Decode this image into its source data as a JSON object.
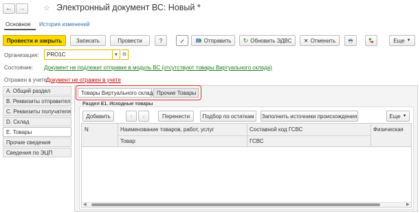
{
  "window": {
    "title": "Электронный документ ВС: Новый *",
    "nav_back": "←",
    "nav_fwd": "→",
    "star": "☆"
  },
  "tabs": {
    "main": "Основное",
    "history": "История изменений"
  },
  "toolbar": {
    "post_close": "Провести и закрыть",
    "save": "Записать",
    "post": "Провести",
    "help": "?",
    "send": "Отправить",
    "refresh": "Обновить ЭДВС",
    "cancel": "Отменить",
    "more": "Еще"
  },
  "form": {
    "org_label": "Организация:",
    "org_value": "PRO1C",
    "state_label": "Состояние:",
    "state_value": "Документ не подлежит отправке в модуль ВС (отсутствуют товары Виртуального склада)",
    "acct_label": "Отражен в учете:",
    "acct_value": "Документ не отражен в учете"
  },
  "sidebar": {
    "items": [
      {
        "label": "А. Общий раздел"
      },
      {
        "label": "В. Реквизиты отправителя"
      },
      {
        "label": "С. Реквизиты получателя"
      },
      {
        "label": "D. Склад"
      },
      {
        "label": "Е. Товары"
      },
      {
        "label": "Прочие сведения"
      },
      {
        "label": "Сведения по ЭЦП"
      }
    ]
  },
  "subtabs": {
    "virtual": "Товары Виртуального склада",
    "other": "Прочие Товары"
  },
  "section": {
    "title": "Раздел Е1. Исходные товары",
    "add": "Добавить",
    "up": "↑",
    "down": "↓",
    "move": "Перенести",
    "pick": "Подбор по остаткам",
    "fill_sources": "Заполнить источники происхождения",
    "more": "Еще"
  },
  "grid": {
    "columns": {
      "n": "N",
      "name": "Наименование товаров, работ, услуг",
      "code": "Составной код ГСВС",
      "phys": "Физическая"
    },
    "subheaders": {
      "item": "Товар",
      "gsvs": "ГСВС"
    }
  },
  "colors": {
    "accent_link": "#3a6ea5",
    "status_green": "#1d7a1d",
    "status_red": "#c00000",
    "primary": "#ffd900",
    "highlight": "#e03030"
  }
}
